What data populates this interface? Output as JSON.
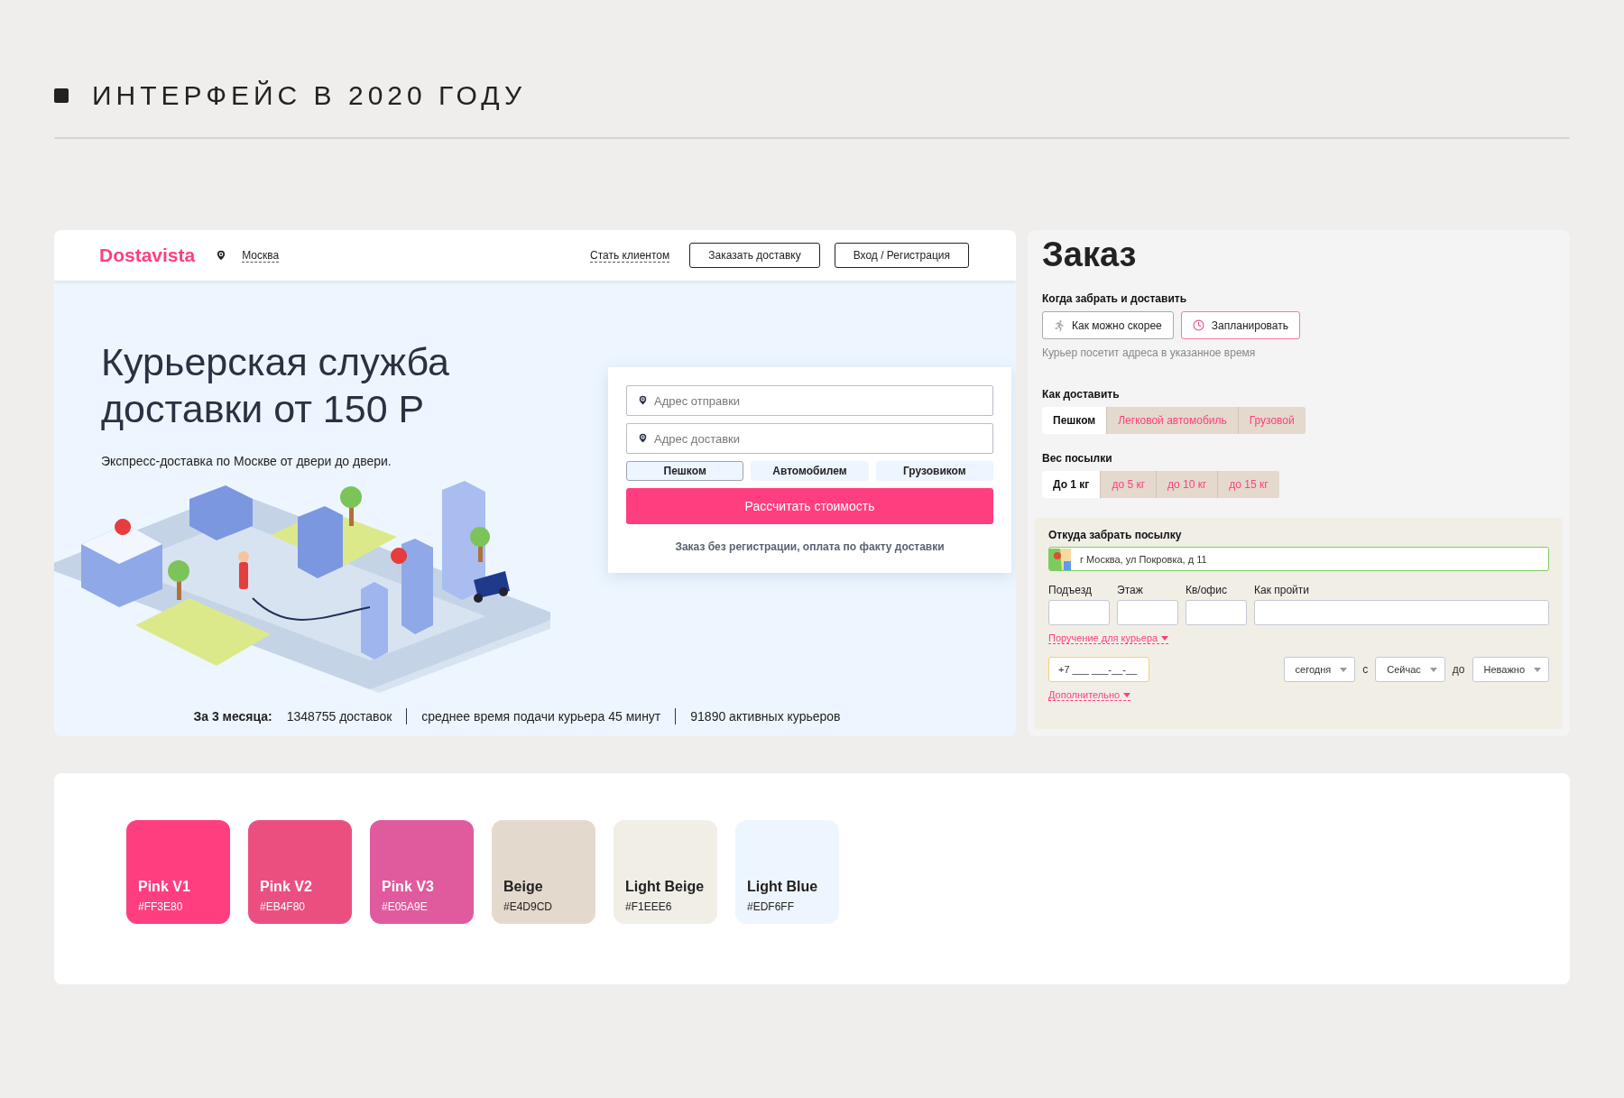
{
  "page_title": "ИНТЕРФЕЙС В 2020 ГОДУ",
  "site": {
    "logo": "Dostavista",
    "city": "Москва",
    "nav": [
      {
        "label": "Стать клиентом",
        "kind": "link"
      },
      {
        "label": "Заказать доставку",
        "kind": "button"
      },
      {
        "label": "Вход / Регистрация",
        "kind": "button"
      }
    ],
    "hero": {
      "title_lines": [
        "Курьерская служба",
        "доставки от 150 Р"
      ],
      "subtitle": "Экспресс-доставка по Москве от двери до двери."
    },
    "calculator": {
      "fields": [
        {
          "placeholder": "Адрес отправки"
        },
        {
          "placeholder": "Адрес доставки"
        }
      ],
      "modes": [
        {
          "label": "Пешком",
          "selected": true
        },
        {
          "label": "Автомобилем",
          "selected": false
        },
        {
          "label": "Грузовиком",
          "selected": false
        }
      ],
      "submit": "Рассчитать стоимость",
      "note": "Заказ без регистрации, оплата по факту доставки"
    },
    "stats": {
      "label": "За 3 месяца:",
      "items": [
        "1348755 доставок",
        "среднее время подачи курьера 45 минут",
        "91890 активных курьеров"
      ]
    }
  },
  "order": {
    "title": "Заказ",
    "when": {
      "label": "Когда забрать и доставить",
      "options": [
        {
          "label": "Как можно скорее",
          "selected": false
        },
        {
          "label": "Запланировать",
          "selected": true
        }
      ],
      "hint": "Курьер посетит адреса в указанное время"
    },
    "transport": {
      "label": "Как доставить",
      "options": [
        {
          "label": "Пешком",
          "selected": true
        },
        {
          "label": "Легковой автомобиль",
          "selected": false
        },
        {
          "label": "Грузовой",
          "selected": false
        }
      ]
    },
    "weight": {
      "label": "Вес посылки",
      "options": [
        {
          "label": "До 1 кг",
          "selected": true
        },
        {
          "label": "до 5 кг",
          "selected": false
        },
        {
          "label": "до 10 кг",
          "selected": false
        },
        {
          "label": "до 15 кг",
          "selected": false
        }
      ]
    },
    "pickup": {
      "label": "Откуда забрать посылку",
      "address": "г Москва, ул Покровка, д 11",
      "fields": [
        {
          "label": "Подъезд"
        },
        {
          "label": "Этаж"
        },
        {
          "label": "Кв/офис"
        },
        {
          "label": "Как пройти"
        }
      ],
      "courier_link": "Поручение для курьера",
      "phone_placeholder": "+7 ___ ___-__-__",
      "date": "сегодня",
      "from_label": "с",
      "from": "Сейчас",
      "to_label": "до",
      "to": "Неважно",
      "more_link": "Дополнительно"
    }
  },
  "palette": [
    {
      "name": "Pink V1",
      "hex": "#FF3E80",
      "color": "#ff3e80"
    },
    {
      "name": "Pink V2",
      "hex": "#EB4F80",
      "color": "#eb4f80"
    },
    {
      "name": "Pink V3",
      "hex": "#E05A9E",
      "color": "#e05a9e"
    },
    {
      "name": "Beige",
      "hex": "#E4D9CD",
      "color": "#e4d9cd"
    },
    {
      "name": "Light Beige",
      "hex": "#F1EEE6",
      "color": "#f1eee6"
    },
    {
      "name": "Light Blue",
      "hex": "#EDF6FF",
      "color": "#edf6ff"
    }
  ]
}
